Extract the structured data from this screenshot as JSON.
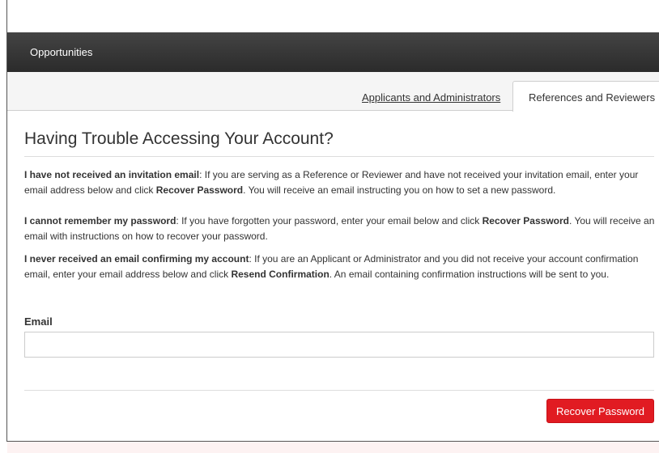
{
  "navbar": {
    "brand": "Opportunities"
  },
  "tabs": {
    "link": "Applicants and Administrators",
    "active": "References and Reviewers"
  },
  "page": {
    "title": "Having Trouble Accessing Your Account?"
  },
  "paragraphs": [
    {
      "bold": "I have not received an invitation email",
      "before_action": ": If you are serving as a Reference or Reviewer and have not received your invitation email, enter your email address below and click ",
      "action": "Recover Password",
      "after_action": ". You will receive an email instructing you on how to set a new password."
    },
    {
      "bold": "I cannot remember my password",
      "before_action": ": If you have forgotten your password, enter your email below and click ",
      "action": "Recover Password",
      "after_action": ". You will receive an email with instructions on how to recover your password."
    },
    {
      "bold": "I never received an email confirming my account",
      "before_action": ": If you are an Applicant or Administrator and you did not receive your account confirmation email, enter your email address below and click ",
      "action": "Resend Confirmation",
      "after_action": ". An email containing confirmation instructions will be sent to you."
    }
  ],
  "form": {
    "email_label": "Email",
    "email_value": "",
    "email_placeholder": ""
  },
  "actions": {
    "recover_label": "Recover Password"
  },
  "colors": {
    "navbar": "#2b2b2b",
    "primary_button": "#e11b22"
  }
}
